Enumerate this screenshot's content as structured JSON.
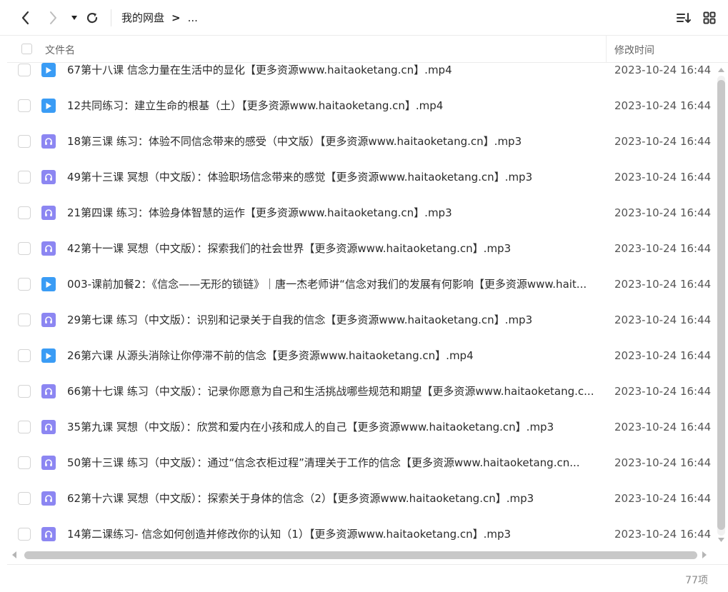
{
  "toolbar": {
    "back_icon": "chevron-left-icon",
    "forward_icon": "chevron-right-icon",
    "dropdown_icon": "caret-down-icon",
    "refresh_icon": "refresh-icon",
    "breadcrumb_root": "我的网盘",
    "breadcrumb_sep": ">",
    "breadcrumb_more": "...",
    "sort_icon": "sort-icon",
    "view_icon": "grid-view-icon"
  },
  "header": {
    "name": "文件名",
    "time": "修改时间"
  },
  "files": [
    {
      "type": "video",
      "name": "67第十八课 信念力量在生活中的显化【更多资源www.haitaoketang.cn】.mp4",
      "time": "2023-10-24 16:44"
    },
    {
      "type": "video",
      "name": "12共同练习：建立生命的根基（土）【更多资源www.haitaoketang.cn】.mp4",
      "time": "2023-10-24 16:44"
    },
    {
      "type": "audio",
      "name": "18第三课 练习：体验不同信念带来的感受（中文版）【更多资源www.haitaoketang.cn】.mp3",
      "time": "2023-10-24 16:44"
    },
    {
      "type": "audio",
      "name": "49第十三课 冥想（中文版）：体验职场信念带来的感觉【更多资源www.haitaoketang.cn】.mp3",
      "time": "2023-10-24 16:44"
    },
    {
      "type": "audio",
      "name": "21第四课 练习：体验身体智慧的运作【更多资源www.haitaoketang.cn】.mp3",
      "time": "2023-10-24 16:44"
    },
    {
      "type": "audio",
      "name": "42第十一课 冥想（中文版）：探索我们的社会世界【更多资源www.haitaoketang.cn】.mp3",
      "time": "2023-10-24 16:44"
    },
    {
      "type": "video",
      "name": "003-课前加餐2：《信念——无形的锁链》｜唐一杰老师讲“信念对我们的发展有何影响【更多资源www.hait...",
      "time": "2023-10-24 16:44"
    },
    {
      "type": "audio",
      "name": "29第七课 练习（中文版）：识别和记录关于自我的信念【更多资源www.haitaoketang.cn】.mp3",
      "time": "2023-10-24 16:44"
    },
    {
      "type": "video",
      "name": "26第六课 从源头消除让你停滞不前的信念【更多资源www.haitaoketang.cn】.mp4",
      "time": "2023-10-24 16:44"
    },
    {
      "type": "audio",
      "name": "66第十七课 练习（中文版）：记录你愿意为自己和生活挑战哪些规范和期望【更多资源www.haitaoketang.c...",
      "time": "2023-10-24 16:44"
    },
    {
      "type": "audio",
      "name": "35第九课 冥想（中文版）：欣赏和爱内在小孩和成人的自己【更多资源www.haitaoketang.cn】.mp3",
      "time": "2023-10-24 16:44"
    },
    {
      "type": "audio",
      "name": "50第十三课 练习（中文版）：通过“信念衣柜过程”清理关于工作的信念【更多资源www.haitaoketang.cn...",
      "time": "2023-10-24 16:44"
    },
    {
      "type": "audio",
      "name": "62第十六课 冥想（中文版）：探索关于身体的信念（2）【更多资源www.haitaoketang.cn】.mp3",
      "time": "2023-10-24 16:44"
    },
    {
      "type": "audio",
      "name": "14第二课练习- 信念如何创造并修改你的认知（1）【更多资源www.haitaoketang.cn】.mp3",
      "time": "2023-10-24 16:44"
    }
  ],
  "footer": {
    "count": "77项"
  },
  "colors": {
    "video": "#3a9cf5",
    "audio": "#8c86f2"
  }
}
